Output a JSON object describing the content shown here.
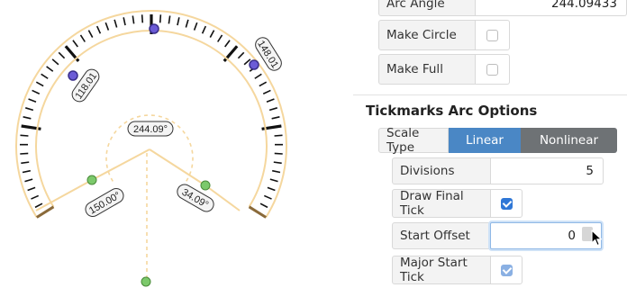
{
  "gauge": {
    "angle_readout": "244.09°",
    "start_angle_readout": "150.00°",
    "end_angle_readout": "34.09°",
    "left_tick_readout": "118.01",
    "right_tick_readout": "148.01",
    "arc_color": "#f5d79e",
    "handle_purple": "#6b5bd6",
    "handle_green": "#7cc96b"
  },
  "panel": {
    "arc_angle": {
      "label": "Arc Angle",
      "value": "244.09433"
    },
    "make_circle": {
      "label": "Make Circle",
      "checked": false
    },
    "make_full": {
      "label": "Make Full",
      "checked": false
    },
    "section_title": "Tickmarks Arc Options",
    "scale_type": {
      "label": "Scale Type",
      "options": [
        "Linear",
        "Nonlinear"
      ],
      "selected": "Linear"
    },
    "divisions": {
      "label": "Divisions",
      "value": "5"
    },
    "draw_final_tick": {
      "label": "Draw Final Tick",
      "checked": true
    },
    "start_offset": {
      "label": "Start Offset",
      "value": "0"
    },
    "major_start_tick": {
      "label": "Major Start Tick",
      "checked": true
    }
  }
}
